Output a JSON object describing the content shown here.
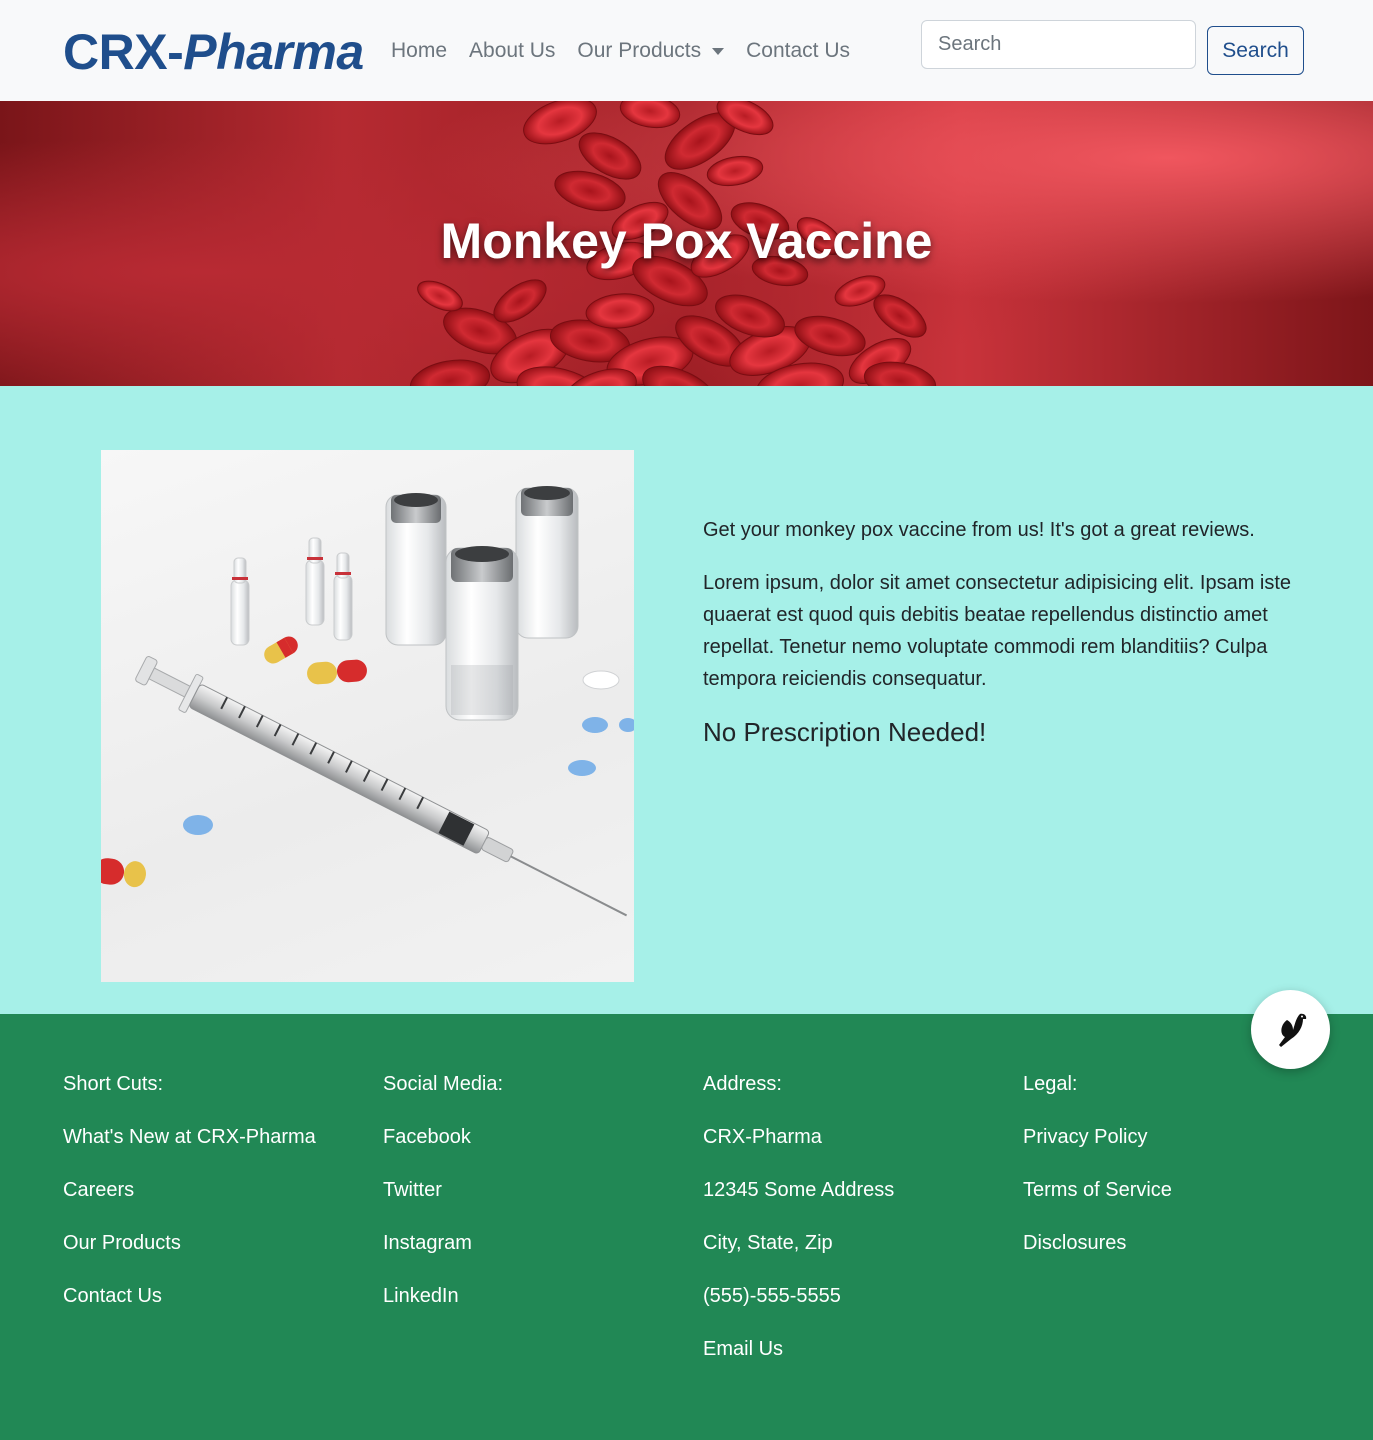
{
  "navbar": {
    "brand_prefix": "CRX-",
    "brand_suffix": "Pharma",
    "links": [
      {
        "label": "Home"
      },
      {
        "label": "About Us"
      },
      {
        "label": "Our Products",
        "dropdown": true
      },
      {
        "label": "Contact Us"
      }
    ],
    "search_placeholder": "Search",
    "search_button": "Search",
    "brand_color": "#1f4e8c"
  },
  "hero": {
    "title": "Monkey Pox Vaccine",
    "background": "red-blood-cells-image"
  },
  "product": {
    "image": "vaccine-vials-syringe-pills-image",
    "lead": "Get your monkey pox vaccine from us! It's got a great reviews.",
    "body": "Lorem ipsum, dolor sit amet consectetur adipisicing elit. Ipsam iste quaerat est quod quis debitis beatae repellendus distinctio amet repellat. Tenetur nemo voluptate commodi rem blanditiis? Culpa tempora reiciendis consequatur.",
    "tagline": "No Prescription Needed!"
  },
  "footer": {
    "columns": [
      {
        "heading": "Short Cuts:",
        "items": [
          "What's New at CRX-Pharma",
          "Careers",
          "Our Products",
          "Contact Us"
        ]
      },
      {
        "heading": "Social Media:",
        "items": [
          "Facebook",
          "Twitter",
          "Instagram",
          "LinkedIn"
        ]
      },
      {
        "heading": "Address:",
        "items": [
          "CRX-Pharma",
          "12345 Some Address",
          "City, State, Zip",
          "(555)-555-5555",
          "Email Us"
        ]
      },
      {
        "heading": "Legal:",
        "items": [
          "Privacy Policy",
          "Terms of Service",
          "Disclosures"
        ]
      }
    ],
    "background": "#218855"
  },
  "chat_widget": {
    "icon": "bird-icon"
  }
}
